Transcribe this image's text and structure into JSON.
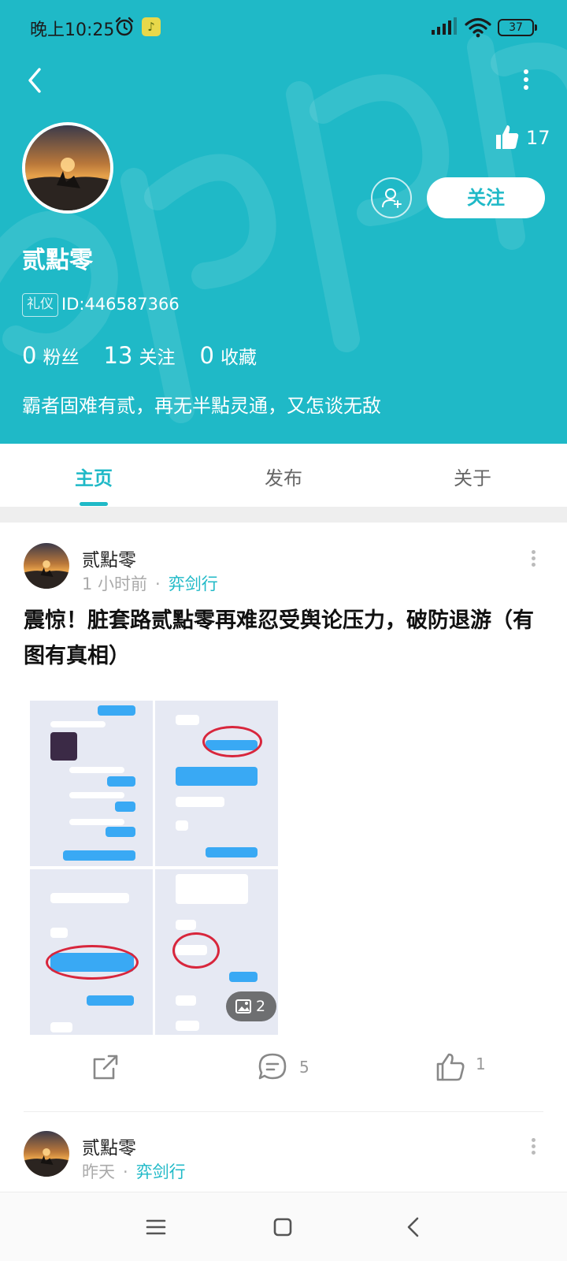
{
  "status_bar": {
    "time": "晚上10:25",
    "battery": "37",
    "app_glyph": "♪",
    "icons": [
      "alarm-icon",
      "music-app-icon",
      "signal-icon",
      "wifi-icon",
      "battery-icon"
    ]
  },
  "colors": {
    "brand": "#1fb9c7",
    "header_bg": "#1fb9c7",
    "accent_text": "#1fb9c7",
    "bubble_blue": "#39a9f4",
    "circle_red": "#d8263c"
  },
  "profile": {
    "name": "贰點零",
    "tag": "礼仪",
    "id_text": "ID:446587366",
    "likes_count": "17",
    "follow_label": "关注",
    "stats": [
      {
        "num": "0",
        "label": "粉丝"
      },
      {
        "num": "13",
        "label": "关注"
      },
      {
        "num": "0",
        "label": "收藏"
      }
    ],
    "bio": "霸者固难有贰，再无半點灵通，又怎谈无敌"
  },
  "tabs": [
    {
      "label": "主页",
      "active": true
    },
    {
      "label": "发布",
      "active": false
    },
    {
      "label": "关于",
      "active": false
    }
  ],
  "posts": [
    {
      "author": "贰點零",
      "time": "1 小时前",
      "separator": "·",
      "forum": "弈剑行",
      "title": "震惊！脏套路贰點零再难忍受舆论压力，破防退游（有图有真相）",
      "image_count": "2",
      "share_icon": "share-icon",
      "comments": "5",
      "likes": "1"
    },
    {
      "author": "贰點零",
      "time": "昨天",
      "separator": "·",
      "forum": "弈剑行"
    }
  ],
  "nav": [
    "menu-icon",
    "home-icon",
    "back-icon"
  ]
}
